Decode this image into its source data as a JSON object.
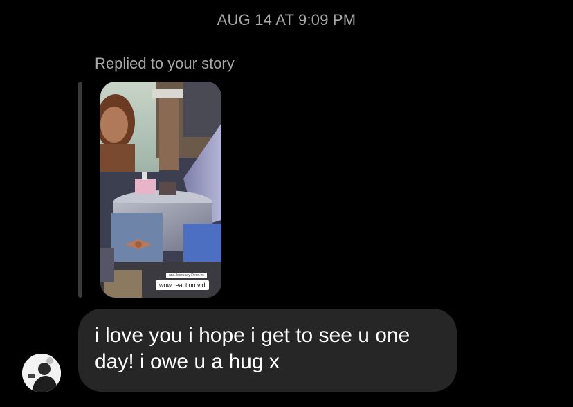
{
  "thread": {
    "timestamp": "AUG 14 AT 9:09 PM",
    "reply_context": "Replied to your story",
    "story": {
      "caption": "wow reaction vid",
      "mini_caption": "ana.ilovec.ury Reen.vs"
    },
    "message": {
      "text": "i love you i hope i get to see u one day! i owe u a hug x"
    }
  },
  "colors": {
    "background": "#000000",
    "bubble": "#262626",
    "secondary_text": "#a8a8a8"
  }
}
